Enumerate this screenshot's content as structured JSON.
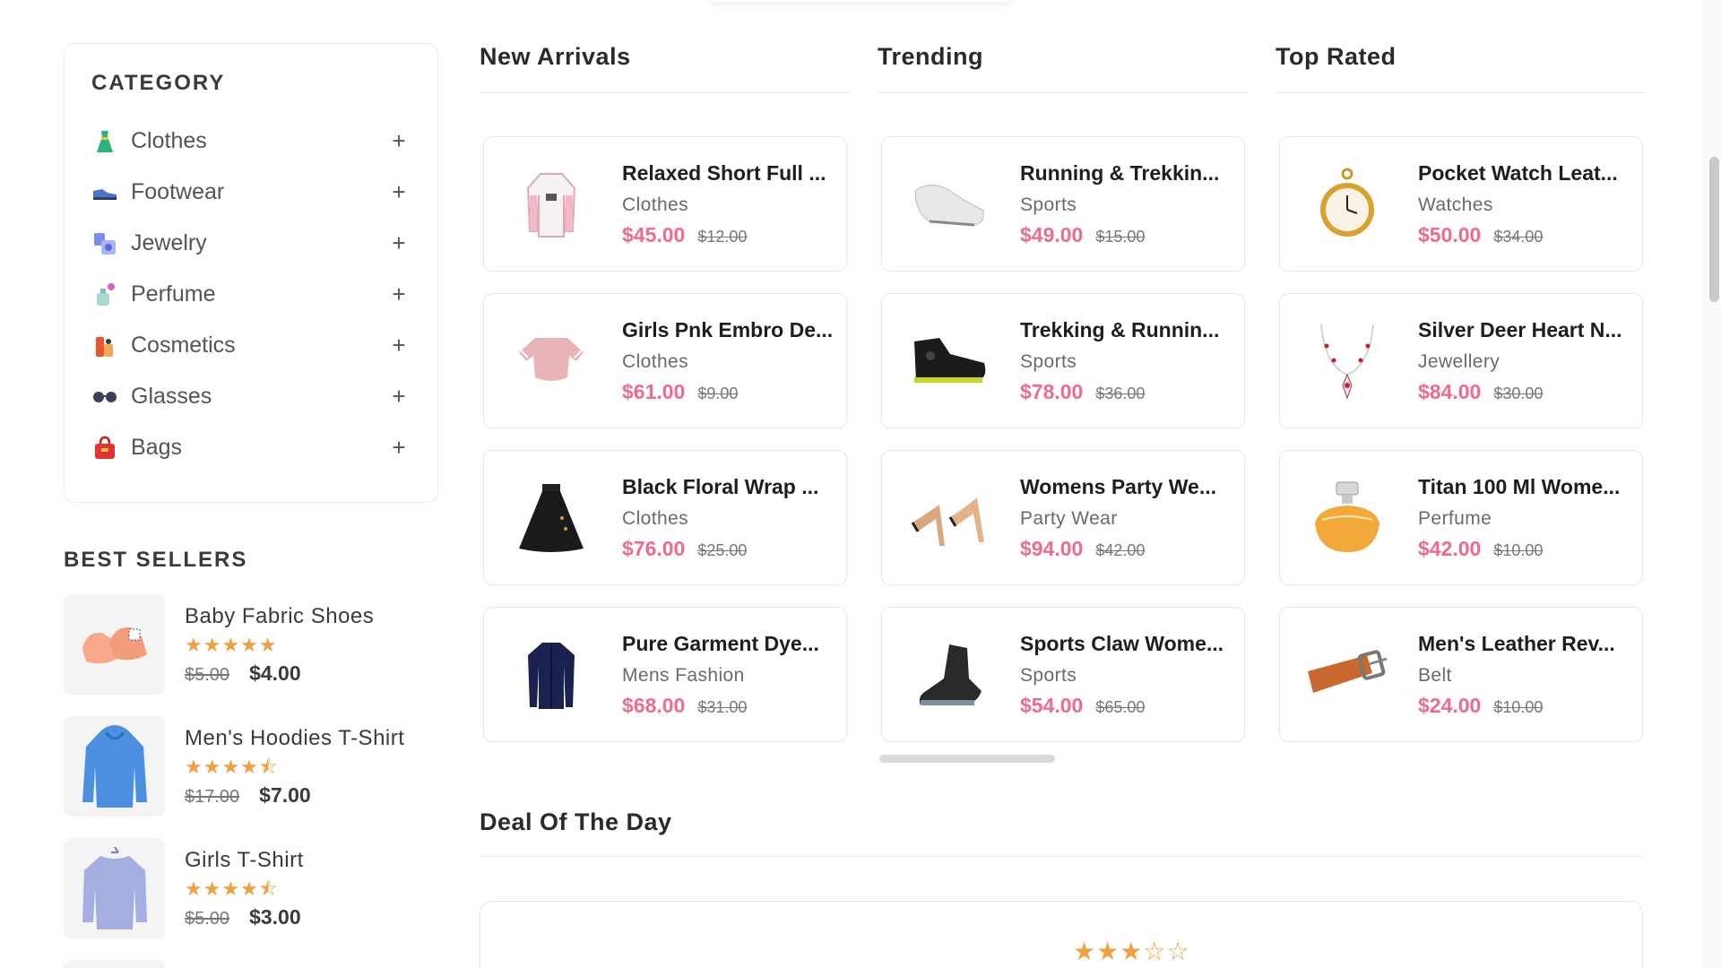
{
  "sidebar": {
    "category_title": "CATEGORY",
    "categories": [
      {
        "label": "Clothes",
        "icon": "dress-icon"
      },
      {
        "label": "Footwear",
        "icon": "shoe-icon"
      },
      {
        "label": "Jewelry",
        "icon": "jewelry-icon"
      },
      {
        "label": "Perfume",
        "icon": "perfume-icon"
      },
      {
        "label": "Cosmetics",
        "icon": "cosmetics-icon"
      },
      {
        "label": "Glasses",
        "icon": "glasses-icon"
      },
      {
        "label": "Bags",
        "icon": "bag-icon"
      }
    ],
    "expand_symbol": "+",
    "best_sellers_title": "BEST SELLERS",
    "best_sellers": [
      {
        "name": "Baby Fabric Shoes",
        "stars": "★★★★★",
        "old_price": "$5.00",
        "new_price": "$4.00"
      },
      {
        "name": "Men's Hoodies T-Shirt",
        "stars": "★★★★⯪",
        "old_price": "$17.00",
        "new_price": "$7.00"
      },
      {
        "name": "Girls T-Shirt",
        "stars": "★★★★⯪",
        "old_price": "$5.00",
        "new_price": "$3.00"
      }
    ]
  },
  "columns": [
    {
      "title": "New Arrivals",
      "products": [
        {
          "name": "Relaxed Short Full ...",
          "category": "Clothes",
          "price": "$45.00",
          "old_price": "$12.00"
        },
        {
          "name": "Girls Pnk Embro De...",
          "category": "Clothes",
          "price": "$61.00",
          "old_price": "$9.00"
        },
        {
          "name": "Black Floral Wrap ...",
          "category": "Clothes",
          "price": "$76.00",
          "old_price": "$25.00"
        },
        {
          "name": "Pure Garment Dye...",
          "category": "Mens Fashion",
          "price": "$68.00",
          "old_price": "$31.00"
        }
      ]
    },
    {
      "title": "Trending",
      "products": [
        {
          "name": "Running & Trekkin...",
          "category": "Sports",
          "price": "$49.00",
          "old_price": "$15.00"
        },
        {
          "name": "Trekking & Runnin...",
          "category": "Sports",
          "price": "$78.00",
          "old_price": "$36.00"
        },
        {
          "name": "Womens Party We...",
          "category": "Party Wear",
          "price": "$94.00",
          "old_price": "$42.00"
        },
        {
          "name": "Sports Claw Wome...",
          "category": "Sports",
          "price": "$54.00",
          "old_price": "$65.00"
        }
      ]
    },
    {
      "title": "Top Rated",
      "products": [
        {
          "name": "Pocket Watch Leat...",
          "category": "Watches",
          "price": "$50.00",
          "old_price": "$34.00"
        },
        {
          "name": "Silver Deer Heart N...",
          "category": "Jewellery",
          "price": "$84.00",
          "old_price": "$30.00"
        },
        {
          "name": "Titan 100 Ml Wome...",
          "category": "Perfume",
          "price": "$42.00",
          "old_price": "$10.00"
        },
        {
          "name": "Men's Leather Rev...",
          "category": "Belt",
          "price": "$24.00",
          "old_price": "$10.00"
        }
      ]
    }
  ],
  "deal": {
    "title": "Deal Of The Day",
    "stars": "★★★☆☆"
  },
  "colors": {
    "accent_price": "#ef6b8a",
    "star": "#f0a040"
  }
}
